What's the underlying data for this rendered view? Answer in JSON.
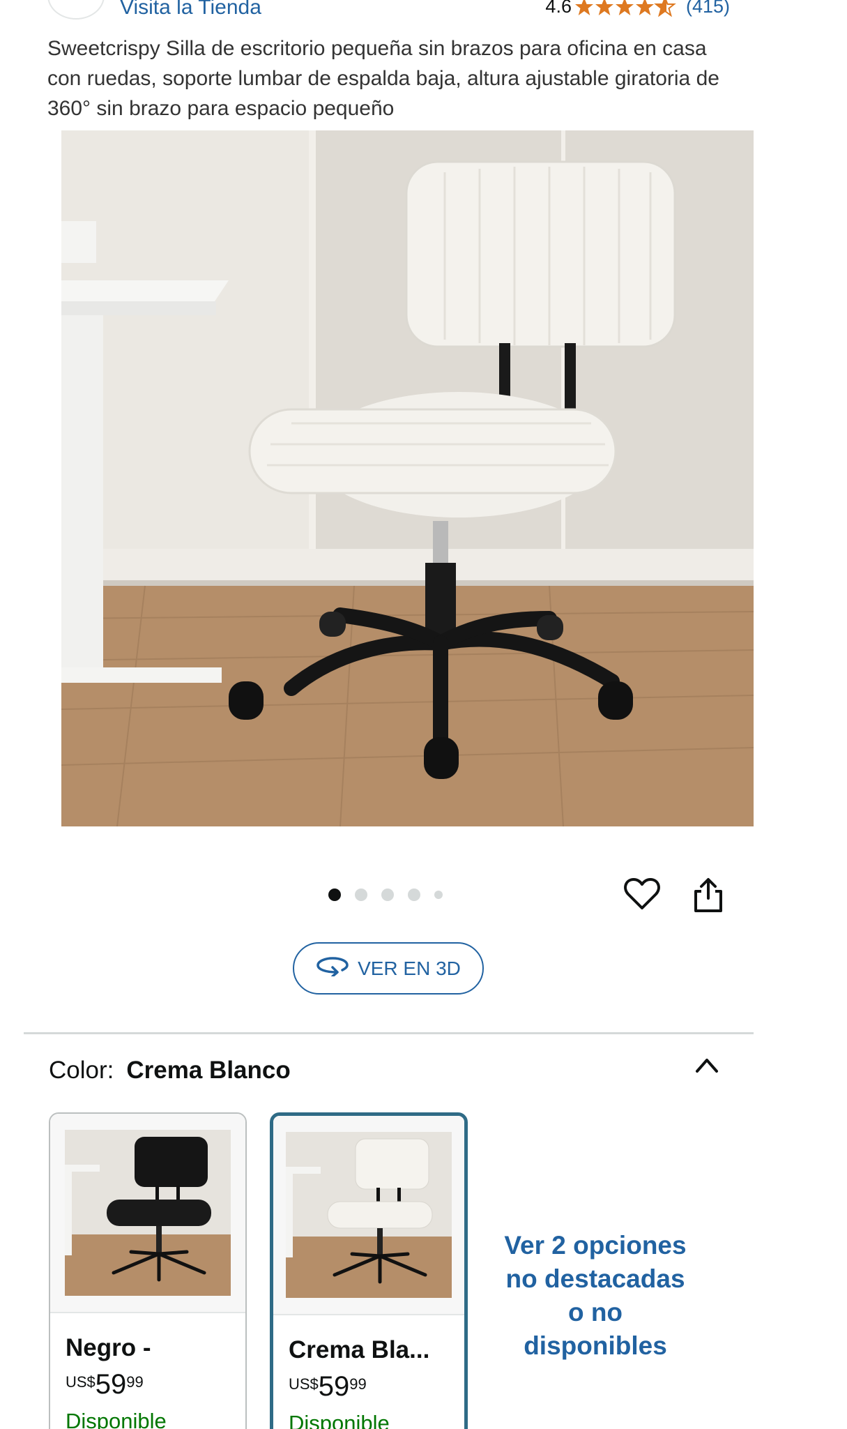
{
  "store": {
    "link_text": "Visita la Tienda"
  },
  "rating": {
    "value": "4.6",
    "stars": 4.6,
    "reviews": "(415)"
  },
  "product": {
    "title": "Sweetcrispy Silla de escritorio pequeña sin brazos para oficina en casa con ruedas, soporte lumbar de espalda baja, altura ajustable giratoria de 360° sin brazo para espacio pequeño"
  },
  "gallery": {
    "total_images": 5,
    "active_index": 0
  },
  "view3d": {
    "label": "VER EN 3D"
  },
  "color_selector": {
    "label": "Color:",
    "selected": "Crema Blanco",
    "options": [
      {
        "name": "Negro -",
        "currency": "US$",
        "whole": "59",
        "fraction": "99",
        "availability": "Disponible"
      },
      {
        "name": "Crema Bla...",
        "currency": "US$",
        "whole": "59",
        "fraction": "99",
        "availability": "Disponible"
      }
    ],
    "more_options": "Ver 2 opciones no destacadas o no disponibles"
  },
  "colors": {
    "link": "#2162a1",
    "star": "#de7921",
    "available": "#007600",
    "selected_border": "#2f6b86"
  }
}
